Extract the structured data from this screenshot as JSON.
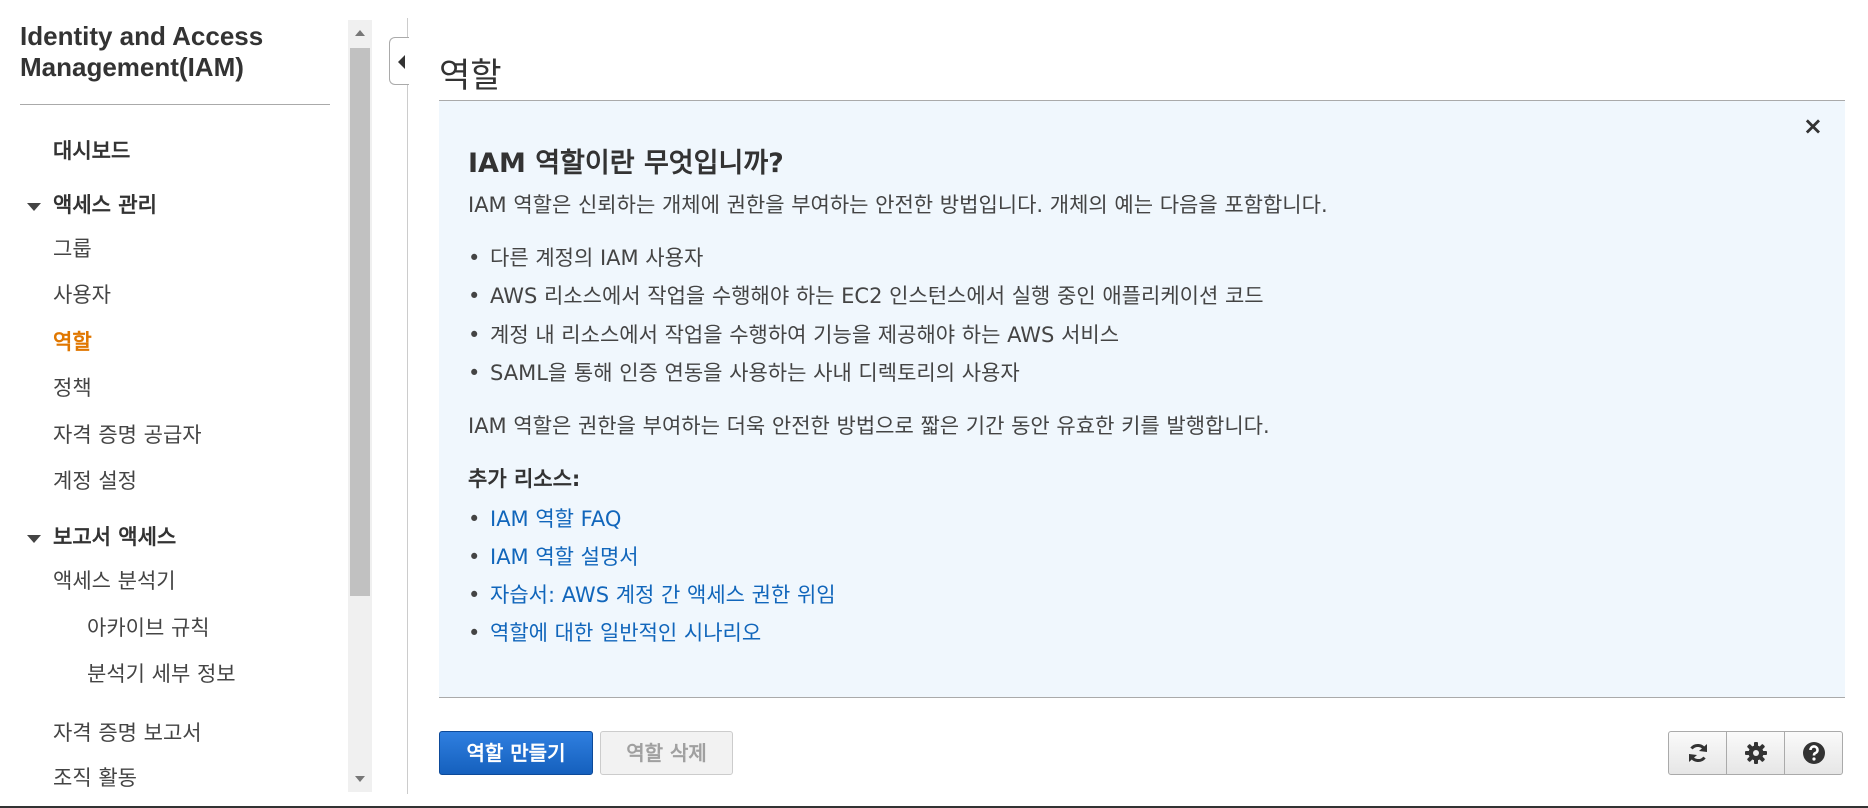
{
  "sidebar": {
    "title": "Identity and Access Management(IAM)",
    "dashboard": "대시보드",
    "access_mgmt": {
      "label": "액세스 관리",
      "items": [
        "그룹",
        "사용자",
        "역할",
        "정책",
        "자격 증명 공급자",
        "계정 설정"
      ],
      "active": "역할"
    },
    "report_access": {
      "label": "보고서 액세스",
      "analyzer": "액세스 분석기",
      "sub_items": [
        "아카이브 규칙",
        "분석기 세부 정보"
      ],
      "credential_report": "자격 증명 보고서",
      "org_activity": "조직 활동"
    }
  },
  "main": {
    "title": "역할",
    "info": {
      "heading": "IAM 역할이란 무엇입니까?",
      "intro": "IAM 역할은 신뢰하는 개체에 권한을 부여하는 안전한 방법입니다. 개체의 예는 다음을 포함합니다.",
      "bullets": [
        "다른 계정의 IAM 사용자",
        "AWS 리소스에서 작업을 수행해야 하는 EC2 인스턴스에서 실행 중인 애플리케이션 코드",
        "계정 내 리소스에서 작업을 수행하여 기능을 제공해야 하는 AWS 서비스",
        "SAML을 통해 인증 연동을 사용하는 사내 디렉토리의 사용자"
      ],
      "note": "IAM 역할은 권한을 부여하는 더욱 안전한 방법으로 짧은 기간 동안 유효한 키를 발행합니다.",
      "resources_heading": "추가 리소스:",
      "links": [
        "IAM 역할 FAQ",
        "IAM 역할 설명서",
        "자습서: AWS 계정 간 액세스 권한 위임",
        "역할에 대한 일반적인 시나리오"
      ],
      "close": "×"
    },
    "buttons": {
      "create": "역할 만들기",
      "delete": "역할 삭제"
    },
    "icons": [
      "refresh-icon",
      "gear-icon",
      "help-icon"
    ]
  },
  "colors": {
    "active": "#e07700",
    "link": "#1166bb",
    "primary": "#1560bd",
    "info_bg": "#f0f7fd"
  }
}
